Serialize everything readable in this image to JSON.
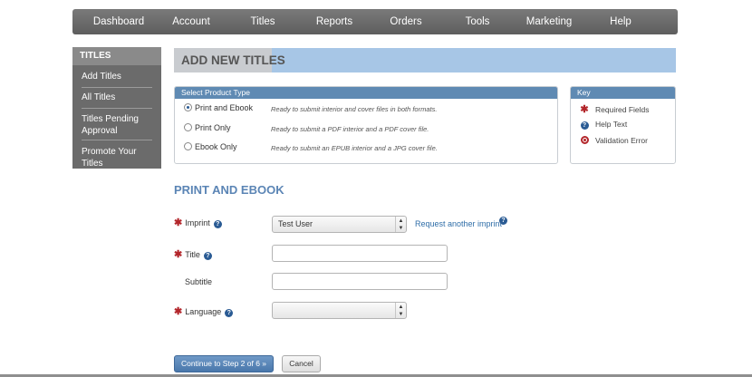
{
  "nav": {
    "items": [
      "Dashboard",
      "Account",
      "Titles",
      "Reports",
      "Orders",
      "Tools",
      "Marketing",
      "Help"
    ]
  },
  "sidebar": {
    "heading": "TITLES",
    "items": [
      "Add Titles",
      "All Titles",
      "Titles Pending Approval",
      "Promote Your Titles"
    ]
  },
  "page": {
    "title": "ADD NEW TITLES",
    "section_title": "PRINT AND EBOOK"
  },
  "product_type": {
    "heading": "Select Product Type",
    "options": [
      {
        "label": "Print and Ebook",
        "desc": "Ready to submit interior and cover files in both formats.",
        "checked": true
      },
      {
        "label": "Print Only",
        "desc": "Ready to submit a PDF interior and a PDF cover file.",
        "checked": false
      },
      {
        "label": "Ebook Only",
        "desc": "Ready to submit an EPUB interior and a JPG cover file.",
        "checked": false
      }
    ]
  },
  "key": {
    "heading": "Key",
    "items": [
      {
        "icon": "required-asterisk-icon",
        "label": "Required Fields"
      },
      {
        "icon": "help-question-icon",
        "label": "Help Text"
      },
      {
        "icon": "validation-error-icon",
        "label": "Validation Error"
      }
    ]
  },
  "form": {
    "imprint_label": "Imprint",
    "imprint_value": "Test User",
    "request_imprint_link": "Request another imprint",
    "title_label": "Title",
    "title_value": "",
    "subtitle_label": "Subtitle",
    "subtitle_value": "",
    "language_label": "Language",
    "language_value": ""
  },
  "actions": {
    "continue_label": "Continue to Step 2 of 6 »",
    "cancel_label": "Cancel"
  },
  "colors": {
    "accent": "#5f8ab3",
    "required": "#b3262b",
    "header_band": "#a7c6e6"
  }
}
